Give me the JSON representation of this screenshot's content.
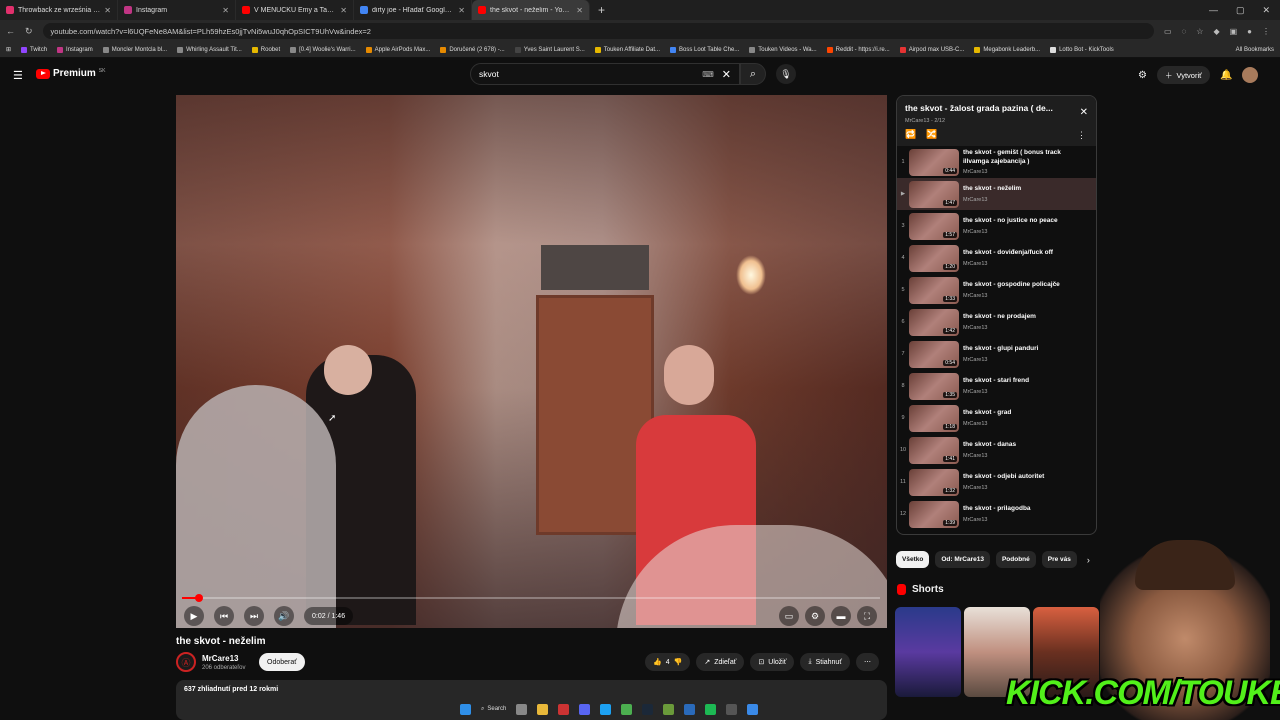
{
  "tabs": [
    {
      "title": "Throwback ze września 😍💕",
      "color": "#e1306c",
      "active": false
    },
    {
      "title": "Instagram",
      "color": "#c13584",
      "active": false
    },
    {
      "title": "V MENÚČKU Emy a Tary padlo",
      "color": "#ff0000",
      "active": false
    },
    {
      "title": "dirty joe - Hľadať Googlom",
      "color": "#4285f4",
      "active": false
    },
    {
      "title": "the skvot - neželim - YouTube",
      "color": "#ff0000",
      "active": true
    }
  ],
  "address": {
    "url": "youtube.com/watch?v=l6UQFeNe8AM&list=PLh59hzEs0jjTvNi5wuJ0qhOpSICT9UhVw&index=2"
  },
  "bookmarks": [
    {
      "label": "Twitch",
      "color": "#9146ff"
    },
    {
      "label": "Instagram",
      "color": "#c13584"
    },
    {
      "label": "Moncler Montcla bl...",
      "color": "#888888"
    },
    {
      "label": "Whirling Assault Tit...",
      "color": "#888888"
    },
    {
      "label": "Roobet",
      "color": "#e6b800"
    },
    {
      "label": "[0.4] Woolie's Warri...",
      "color": "#888888"
    },
    {
      "label": "Apple AirPods Max...",
      "color": "#e68a00"
    },
    {
      "label": "Doručené (2 678) -...",
      "color": "#e68a00"
    },
    {
      "label": "Yves Saint Laurent S...",
      "color": "#444444"
    },
    {
      "label": "Touken Affiliate Dat...",
      "color": "#e6b800"
    },
    {
      "label": "Boss Loot Table Che...",
      "color": "#4285f4"
    },
    {
      "label": "Touken Videos - Wa...",
      "color": "#888888"
    },
    {
      "label": "Reddit - https://i.re...",
      "color": "#ff4500"
    },
    {
      "label": "Airpod max USB-C...",
      "color": "#e63333"
    },
    {
      "label": "Megabonk Leaderb...",
      "color": "#e6b800"
    },
    {
      "label": "Lotto Bot - KickTools",
      "color": "#dddddd"
    }
  ],
  "all_bookmarks": "All Bookmarks",
  "header": {
    "logo_text": "Premium",
    "logo_sup": "SK",
    "search_value": "skvot",
    "create_label": "Vytvoriť"
  },
  "player": {
    "time": "0:02 / 1:46",
    "progress": 0.019
  },
  "video": {
    "title": "the skvot - neželim",
    "channel": "MrCare13",
    "subscribers": "206 odberateľov",
    "subscribe_label": "Odoberať",
    "likes": "4",
    "share_label": "Zdieľať",
    "save_label": "Uložiť",
    "download_label": "Stiahnuť",
    "views_date": "637 zhliadnutí  pred 12 rokmi"
  },
  "playlist": {
    "title": "the skvot - žalost grada pazina ( de...",
    "subtitle": "MrCare13 - 2/12",
    "items": [
      {
        "n": "1",
        "title": "the skvot - gemišt ( bonus track illvamga zajebancija )",
        "channel": "MrCare13",
        "duration": "0:44"
      },
      {
        "n": "▶",
        "title": "the skvot - neželim",
        "channel": "MrCare13",
        "duration": "1:47"
      },
      {
        "n": "3",
        "title": "the skvot - no justice no peace",
        "channel": "MrCare13",
        "duration": "1:57"
      },
      {
        "n": "4",
        "title": "the skvot - doviđenja/fuck off",
        "channel": "MrCare13",
        "duration": "1:20"
      },
      {
        "n": "5",
        "title": "the skvot - gospodine policajče",
        "channel": "MrCare13",
        "duration": "1:33"
      },
      {
        "n": "6",
        "title": "the skvot - ne prodajem",
        "channel": "MrCare13",
        "duration": "1:42"
      },
      {
        "n": "7",
        "title": "the skvot - glupi panduri",
        "channel": "MrCare13",
        "duration": "0:54"
      },
      {
        "n": "8",
        "title": "the skvot - stari frend",
        "channel": "MrCare13",
        "duration": "1:35"
      },
      {
        "n": "9",
        "title": "the skvot - grad",
        "channel": "MrCare13",
        "duration": "1:18"
      },
      {
        "n": "10",
        "title": "the skvot - danas",
        "channel": "MrCare13",
        "duration": "1:41"
      },
      {
        "n": "11",
        "title": "the skvot - odjebi autoritet",
        "channel": "MrCare13",
        "duration": "1:32"
      },
      {
        "n": "12",
        "title": "the skvot - prilagodba",
        "channel": "MrCare13",
        "duration": "1:39"
      }
    ]
  },
  "chips": [
    "Všetko",
    "Od: MrCare13",
    "Podobné",
    "Pre vás"
  ],
  "shorts_label": "Shorts",
  "overlay": {
    "kick_text": "KICK.COM/TOUKEN"
  },
  "taskbar": {
    "search_label": "Search"
  }
}
